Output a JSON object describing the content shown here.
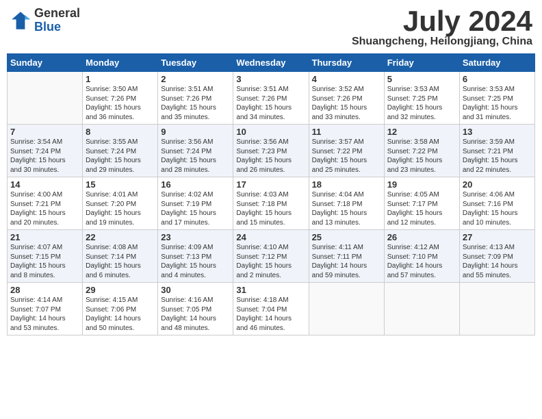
{
  "logo": {
    "general": "General",
    "blue": "Blue"
  },
  "title": {
    "month": "July 2024",
    "location": "Shuangcheng, Heilongjiang, China"
  },
  "headers": [
    "Sunday",
    "Monday",
    "Tuesday",
    "Wednesday",
    "Thursday",
    "Friday",
    "Saturday"
  ],
  "weeks": [
    [
      {
        "day": "",
        "info": ""
      },
      {
        "day": "1",
        "info": "Sunrise: 3:50 AM\nSunset: 7:26 PM\nDaylight: 15 hours\nand 36 minutes."
      },
      {
        "day": "2",
        "info": "Sunrise: 3:51 AM\nSunset: 7:26 PM\nDaylight: 15 hours\nand 35 minutes."
      },
      {
        "day": "3",
        "info": "Sunrise: 3:51 AM\nSunset: 7:26 PM\nDaylight: 15 hours\nand 34 minutes."
      },
      {
        "day": "4",
        "info": "Sunrise: 3:52 AM\nSunset: 7:26 PM\nDaylight: 15 hours\nand 33 minutes."
      },
      {
        "day": "5",
        "info": "Sunrise: 3:53 AM\nSunset: 7:25 PM\nDaylight: 15 hours\nand 32 minutes."
      },
      {
        "day": "6",
        "info": "Sunrise: 3:53 AM\nSunset: 7:25 PM\nDaylight: 15 hours\nand 31 minutes."
      }
    ],
    [
      {
        "day": "7",
        "info": "Sunrise: 3:54 AM\nSunset: 7:24 PM\nDaylight: 15 hours\nand 30 minutes."
      },
      {
        "day": "8",
        "info": "Sunrise: 3:55 AM\nSunset: 7:24 PM\nDaylight: 15 hours\nand 29 minutes."
      },
      {
        "day": "9",
        "info": "Sunrise: 3:56 AM\nSunset: 7:24 PM\nDaylight: 15 hours\nand 28 minutes."
      },
      {
        "day": "10",
        "info": "Sunrise: 3:56 AM\nSunset: 7:23 PM\nDaylight: 15 hours\nand 26 minutes."
      },
      {
        "day": "11",
        "info": "Sunrise: 3:57 AM\nSunset: 7:22 PM\nDaylight: 15 hours\nand 25 minutes."
      },
      {
        "day": "12",
        "info": "Sunrise: 3:58 AM\nSunset: 7:22 PM\nDaylight: 15 hours\nand 23 minutes."
      },
      {
        "day": "13",
        "info": "Sunrise: 3:59 AM\nSunset: 7:21 PM\nDaylight: 15 hours\nand 22 minutes."
      }
    ],
    [
      {
        "day": "14",
        "info": "Sunrise: 4:00 AM\nSunset: 7:21 PM\nDaylight: 15 hours\nand 20 minutes."
      },
      {
        "day": "15",
        "info": "Sunrise: 4:01 AM\nSunset: 7:20 PM\nDaylight: 15 hours\nand 19 minutes."
      },
      {
        "day": "16",
        "info": "Sunrise: 4:02 AM\nSunset: 7:19 PM\nDaylight: 15 hours\nand 17 minutes."
      },
      {
        "day": "17",
        "info": "Sunrise: 4:03 AM\nSunset: 7:18 PM\nDaylight: 15 hours\nand 15 minutes."
      },
      {
        "day": "18",
        "info": "Sunrise: 4:04 AM\nSunset: 7:18 PM\nDaylight: 15 hours\nand 13 minutes."
      },
      {
        "day": "19",
        "info": "Sunrise: 4:05 AM\nSunset: 7:17 PM\nDaylight: 15 hours\nand 12 minutes."
      },
      {
        "day": "20",
        "info": "Sunrise: 4:06 AM\nSunset: 7:16 PM\nDaylight: 15 hours\nand 10 minutes."
      }
    ],
    [
      {
        "day": "21",
        "info": "Sunrise: 4:07 AM\nSunset: 7:15 PM\nDaylight: 15 hours\nand 8 minutes."
      },
      {
        "day": "22",
        "info": "Sunrise: 4:08 AM\nSunset: 7:14 PM\nDaylight: 15 hours\nand 6 minutes."
      },
      {
        "day": "23",
        "info": "Sunrise: 4:09 AM\nSunset: 7:13 PM\nDaylight: 15 hours\nand 4 minutes."
      },
      {
        "day": "24",
        "info": "Sunrise: 4:10 AM\nSunset: 7:12 PM\nDaylight: 15 hours\nand 2 minutes."
      },
      {
        "day": "25",
        "info": "Sunrise: 4:11 AM\nSunset: 7:11 PM\nDaylight: 14 hours\nand 59 minutes."
      },
      {
        "day": "26",
        "info": "Sunrise: 4:12 AM\nSunset: 7:10 PM\nDaylight: 14 hours\nand 57 minutes."
      },
      {
        "day": "27",
        "info": "Sunrise: 4:13 AM\nSunset: 7:09 PM\nDaylight: 14 hours\nand 55 minutes."
      }
    ],
    [
      {
        "day": "28",
        "info": "Sunrise: 4:14 AM\nSunset: 7:07 PM\nDaylight: 14 hours\nand 53 minutes."
      },
      {
        "day": "29",
        "info": "Sunrise: 4:15 AM\nSunset: 7:06 PM\nDaylight: 14 hours\nand 50 minutes."
      },
      {
        "day": "30",
        "info": "Sunrise: 4:16 AM\nSunset: 7:05 PM\nDaylight: 14 hours\nand 48 minutes."
      },
      {
        "day": "31",
        "info": "Sunrise: 4:18 AM\nSunset: 7:04 PM\nDaylight: 14 hours\nand 46 minutes."
      },
      {
        "day": "",
        "info": ""
      },
      {
        "day": "",
        "info": ""
      },
      {
        "day": "",
        "info": ""
      }
    ]
  ]
}
